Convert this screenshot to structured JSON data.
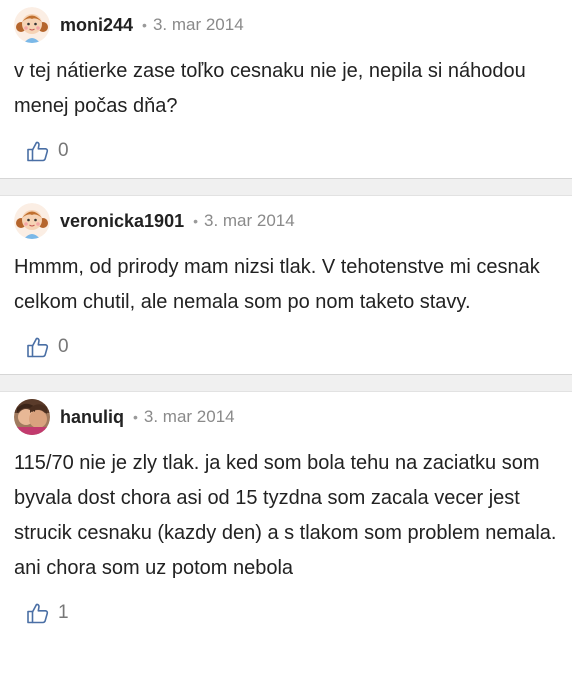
{
  "comments": [
    {
      "author": "moni244",
      "date": "3. mar 2014",
      "text": "v tej nátierke zase toľko cesnaku nie je, nepila si náhodou menej počas dňa?",
      "likes": "0",
      "avatar": "girl-avatar"
    },
    {
      "author": "veronicka1901",
      "date": "3. mar 2014",
      "text": "Hmmm, od prirody mam nizsi tlak. V tehotenstve mi cesnak celkom chutil, ale nemala som po nom taketo stavy.",
      "likes": "0",
      "avatar": "girl-avatar"
    },
    {
      "author": "hanuliq",
      "date": "3. mar 2014",
      "text": "115/70 nie je zly tlak. ja ked som bola tehu na zaciatku som byvala dost chora asi od 15 tyzdna som zacala vecer jest strucik cesnaku (kazdy den) a s tlakom som problem nemala. ani chora som uz potom nebola",
      "likes": "1",
      "avatar": "photo-avatar"
    }
  ],
  "separator": "•",
  "colors": {
    "text": "#222222",
    "meta": "#8a8a8a",
    "divider": "#f0f0f0"
  }
}
